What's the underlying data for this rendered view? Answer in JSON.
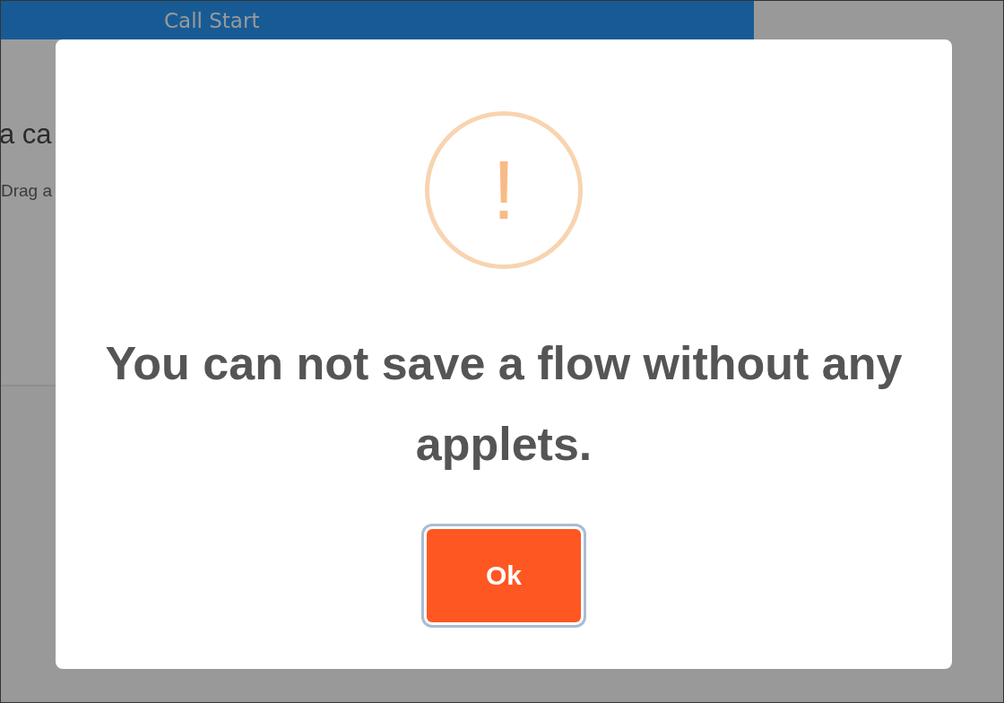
{
  "background": {
    "header_title": "Call Start",
    "heading": "a ca",
    "hint": "Drag a"
  },
  "dialog": {
    "icon": "!",
    "message": "You can not save a flow without any applets.",
    "buttons": [
      {
        "label": "Ok",
        "focused": true
      }
    ]
  }
}
